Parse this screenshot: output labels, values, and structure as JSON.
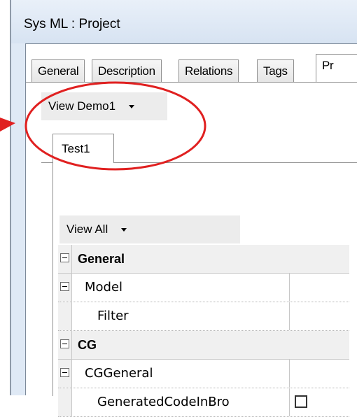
{
  "window": {
    "title": "Sys ML : Project"
  },
  "tabs": [
    {
      "label": "General",
      "active": false
    },
    {
      "label": "Description",
      "active": false
    },
    {
      "label": "Relations",
      "active": false
    },
    {
      "label": "Tags",
      "active": false
    },
    {
      "label": "Pr",
      "active": true
    }
  ],
  "view_selector": {
    "label": "View Demo1"
  },
  "inner_tab": {
    "label": "Test1"
  },
  "view_all": {
    "label": "View All"
  },
  "grid": {
    "rows": [
      {
        "label": "General",
        "category": true,
        "expander": true
      },
      {
        "label": "Model",
        "category": false,
        "expander": true
      },
      {
        "label": "Filter",
        "category": false,
        "expander": false
      },
      {
        "label": "CG",
        "category": true,
        "expander": true
      },
      {
        "label": "CGGeneral",
        "category": false,
        "expander": true
      },
      {
        "label": "GeneratedCodeInBro",
        "category": false,
        "expander": false,
        "checkbox": false
      }
    ]
  },
  "annotation": {
    "color": "#e02020"
  }
}
